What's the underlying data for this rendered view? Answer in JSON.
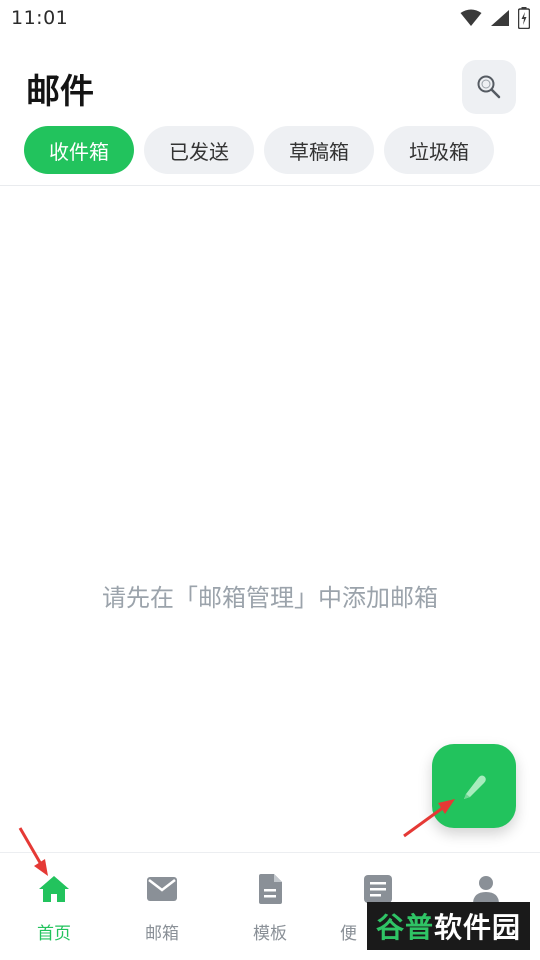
{
  "status_bar": {
    "time": "11:01"
  },
  "header": {
    "title": "邮件"
  },
  "tabs": [
    {
      "label": "收件箱",
      "active": true
    },
    {
      "label": "已发送",
      "active": false
    },
    {
      "label": "草稿箱",
      "active": false
    },
    {
      "label": "垃圾箱",
      "active": false
    }
  ],
  "empty_state": {
    "message": "请先在「邮箱管理」中添加邮箱"
  },
  "bottom_nav": [
    {
      "label": "首页",
      "icon": "home-icon",
      "active": true
    },
    {
      "label": "邮箱",
      "icon": "mail-icon",
      "active": false
    },
    {
      "label": "模板",
      "icon": "document-icon",
      "active": false
    },
    {
      "label": "便",
      "icon": "notes-icon",
      "active": false
    },
    {
      "label": "",
      "icon": "user-icon",
      "active": false
    }
  ],
  "watermark": {
    "part1": "谷普",
    "part2": "软件园"
  },
  "colors": {
    "accent": "#22c35d",
    "annotation": "#e53935"
  }
}
